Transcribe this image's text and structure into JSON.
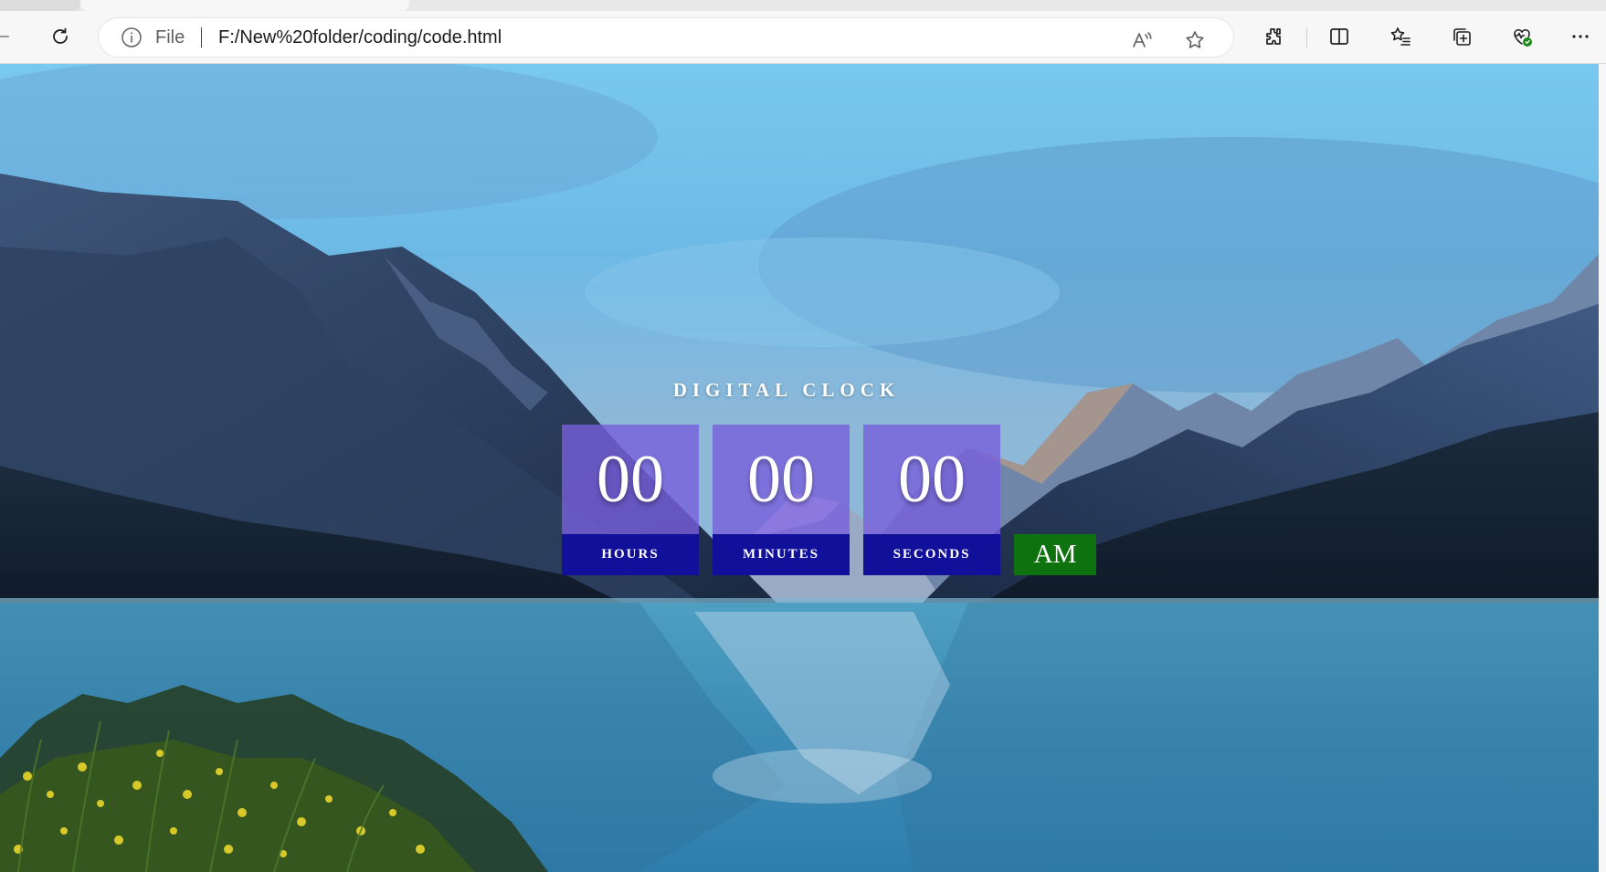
{
  "browser": {
    "address_prefix": "File",
    "url": "F:/New%20folder/coding/code.html",
    "toolbar_icons": [
      "reload-icon",
      "info-icon",
      "read-aloud-icon",
      "favorite-star-icon",
      "extensions-icon",
      "split-screen-icon",
      "favorites-icon",
      "collections-icon",
      "browser-essentials-icon",
      "more-icon"
    ]
  },
  "clock": {
    "title": "DIGITAL CLOCK",
    "hours": {
      "value": "00",
      "label": "HOURS"
    },
    "minutes": {
      "value": "00",
      "label": "MINUTES"
    },
    "seconds": {
      "value": "00",
      "label": "SECONDS"
    },
    "period": "AM"
  },
  "colors": {
    "digit_box": "#785fdc",
    "label_box": "#10109a",
    "period_box": "#0e720e",
    "text": "#ffffff"
  }
}
